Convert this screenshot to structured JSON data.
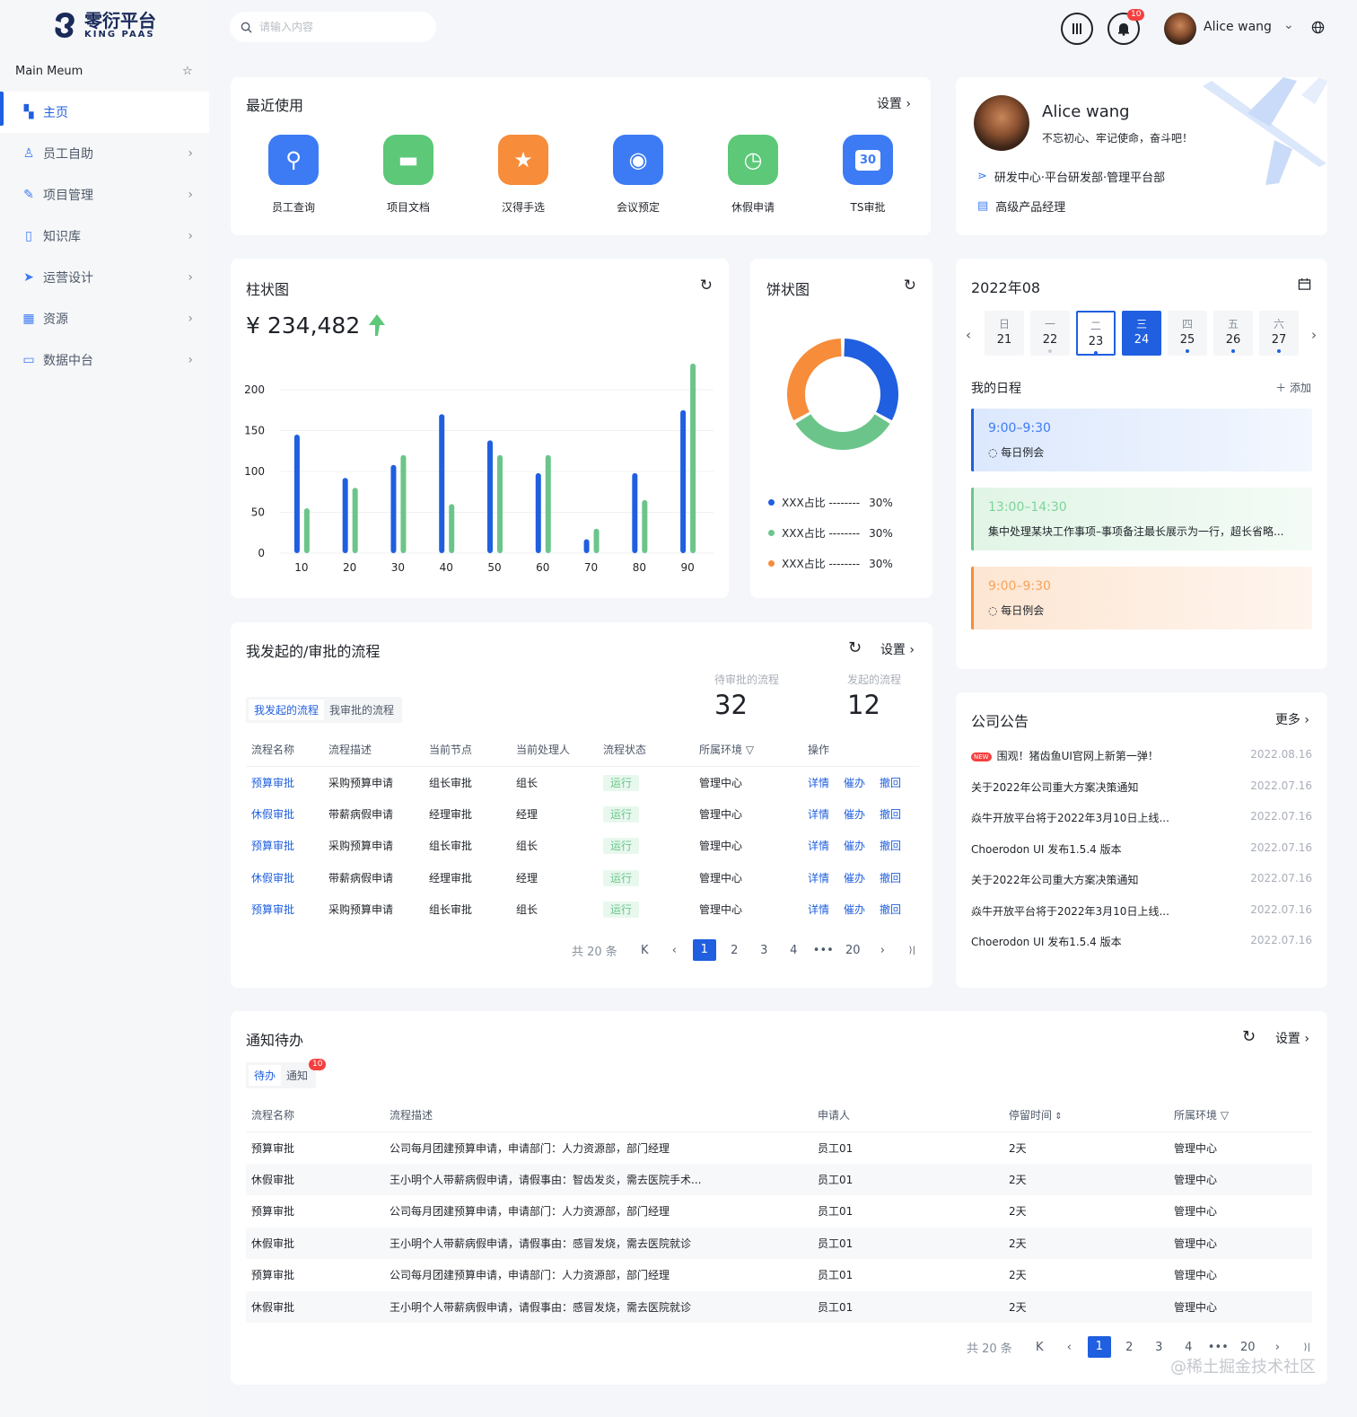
{
  "brand": {
    "name": "零衍平台",
    "sub": "KING PAAS"
  },
  "menu": {
    "title": "Main Meum",
    "items": [
      {
        "label": "主页",
        "icon": "dashboard-icon",
        "active": true
      },
      {
        "label": "员工自助",
        "icon": "user-icon"
      },
      {
        "label": "项目管理",
        "icon": "edit-icon"
      },
      {
        "label": "知识库",
        "icon": "book-icon"
      },
      {
        "label": "运营设计",
        "icon": "send-icon"
      },
      {
        "label": "资源",
        "icon": "grid-icon"
      },
      {
        "label": "数据中台",
        "icon": "monitor-icon"
      }
    ]
  },
  "header": {
    "search_placeholder": "请输入内容",
    "notif_count": "10",
    "user_name": "Alice wang"
  },
  "recent": {
    "title": "最近使用",
    "settings": "设置",
    "apps": [
      {
        "label": "员工查询",
        "color": "#3d7bf4",
        "icon": "user-search-icon"
      },
      {
        "label": "项目文档",
        "color": "#5cc878",
        "icon": "folder-icon"
      },
      {
        "label": "汉得手选",
        "color": "#f78c3a",
        "icon": "star-hand-icon"
      },
      {
        "label": "会议预定",
        "color": "#3d7bf4",
        "icon": "projector-icon"
      },
      {
        "label": "休假申请",
        "color": "#5cc878",
        "icon": "luggage-icon"
      },
      {
        "label": "TS审批",
        "color": "#3d7bf4",
        "icon": "calendar-30-icon",
        "glyph": "30"
      }
    ]
  },
  "profile": {
    "name": "Alice wang",
    "motto": "不忘初心、牢记使命，奋斗吧！",
    "dept": "研发中心·平台研发部·管理平台部",
    "role": "高级产品经理"
  },
  "bar_card": {
    "title": "柱状图",
    "amount": "¥ 234,482"
  },
  "chart_data": [
    {
      "type": "bar",
      "title": "柱状图",
      "categories": [
        "10",
        "20",
        "30",
        "40",
        "50",
        "60",
        "70",
        "80",
        "90"
      ],
      "series": [
        {
          "values": [
            145,
            92,
            108,
            170,
            138,
            98,
            17,
            98,
            175
          ],
          "color": "#1f5fe0"
        },
        {
          "values": [
            55,
            80,
            120,
            60,
            120,
            120,
            30,
            65,
            232
          ],
          "color": "#6bc58a"
        }
      ],
      "ylim": [
        0,
        200
      ],
      "yticks": [
        0,
        50,
        100,
        150,
        200
      ],
      "grid": true
    },
    {
      "type": "pie",
      "title": "饼状图",
      "slices": [
        {
          "label": "XXX占比",
          "value": 30,
          "color": "#1f5fe0"
        },
        {
          "label": "XXX占比",
          "value": 30,
          "color": "#6bc58a"
        },
        {
          "label": "XXX占比",
          "value": 30,
          "color": "#f78c3a"
        }
      ]
    }
  ],
  "pie_card": {
    "title": "饼状图",
    "legend": [
      {
        "label": "XXX占比 --------",
        "pct": "30%",
        "color": "#1f5fe0"
      },
      {
        "label": "XXX占比 --------",
        "pct": "30%",
        "color": "#6bc58a"
      },
      {
        "label": "XXX占比 --------",
        "pct": "30%",
        "color": "#f78c3a"
      }
    ]
  },
  "calendar": {
    "title": "2022年08",
    "days": [
      {
        "wk": "日",
        "d": "21",
        "dot": false
      },
      {
        "wk": "一",
        "d": "22",
        "dot": true,
        "dotColor": "#c9cdd4"
      },
      {
        "wk": "二",
        "d": "23",
        "dot": true,
        "sel": true
      },
      {
        "wk": "三",
        "d": "24",
        "dot": false,
        "today": true
      },
      {
        "wk": "四",
        "d": "25",
        "dot": true
      },
      {
        "wk": "五",
        "d": "26",
        "dot": true
      },
      {
        "wk": "六",
        "d": "27",
        "dot": true
      }
    ],
    "my_schedule": "我的日程",
    "add": "添加",
    "events": [
      {
        "time": "9:00–9:30",
        "desc": "每日例会",
        "color": "#1f5fe0",
        "bg": "linear-gradient(90deg,#dce8fd,#f3f7fe)",
        "tcolor": "#3d7bf4"
      },
      {
        "time": "13:00–14:30",
        "desc": "集中处理某块工作事项–事项备注最长展示为一行，超长省略...",
        "color": "#6bc58a",
        "bg": "linear-gradient(90deg,#e1f5e6,#f4fbf6)",
        "tcolor": "#7fd39a"
      },
      {
        "time": "9:00–9:30",
        "desc": "每日例会",
        "color": "#f78c3a",
        "bg": "linear-gradient(90deg,#fde6d3,#fef5ee)",
        "tcolor": "#f7a35c"
      }
    ]
  },
  "flow": {
    "title": "我发起的/审批的流程",
    "settings": "设置",
    "tab_mine": "我发起的流程",
    "tab_approve": "我审批的流程",
    "pending_label": "待审批的流程",
    "pending_value": "32",
    "started_label": "发起的流程",
    "started_value": "12",
    "columns": [
      "流程名称",
      "流程描述",
      "当前节点",
      "当前处理人",
      "流程状态",
      "所属环境",
      "操作"
    ],
    "rows": [
      {
        "name": "预算审批",
        "desc": "采购预算申请",
        "node": "组长审批",
        "handler": "组长",
        "status": "运行",
        "env": "管理中心"
      },
      {
        "name": "休假审批",
        "desc": "带薪病假申请",
        "node": "经理审批",
        "handler": "经理",
        "status": "运行",
        "env": "管理中心"
      },
      {
        "name": "预算审批",
        "desc": "采购预算申请",
        "node": "组长审批",
        "handler": "组长",
        "status": "运行",
        "env": "管理中心"
      },
      {
        "name": "休假审批",
        "desc": "带薪病假申请",
        "node": "经理审批",
        "handler": "经理",
        "status": "运行",
        "env": "管理中心"
      },
      {
        "name": "预算审批",
        "desc": "采购预算申请",
        "node": "组长审批",
        "handler": "组长",
        "status": "运行",
        "env": "管理中心"
      }
    ],
    "ops": [
      "详情",
      "催办",
      "撤回"
    ],
    "total": "共 20 条",
    "pages": [
      "1",
      "2",
      "3",
      "4",
      "•••",
      "20"
    ]
  },
  "notices": {
    "title": "公司公告",
    "more": "更多",
    "items": [
      {
        "text": "围观！猪齿鱼UI官网上新第一弹！",
        "date": "2022.08.16",
        "new": true
      },
      {
        "text": "关于2022年公司重大方案决策通知",
        "date": "2022.07.16"
      },
      {
        "text": "焱牛开放平台将于2022年3月10日上线...",
        "date": "2022.07.16"
      },
      {
        "text": "Choerodon UI 发布1.5.4 版本",
        "date": "2022.07.16"
      },
      {
        "text": "关于2022年公司重大方案决策通知",
        "date": "2022.07.16"
      },
      {
        "text": "焱牛开放平台将于2022年3月10日上线...",
        "date": "2022.07.16"
      },
      {
        "text": "Choerodon UI 发布1.5.4 版本",
        "date": "2022.07.16"
      }
    ]
  },
  "todo": {
    "title": "通知待办",
    "settings": "设置",
    "tab_todo": "待办",
    "tab_notice": "通知",
    "notice_count": "10",
    "columns": [
      "流程名称",
      "流程描述",
      "申请人",
      "停留时间",
      "所属环境"
    ],
    "rows": [
      {
        "name": "预算审批",
        "desc": "公司每月团建预算申请，申请部门：人力资源部，部门经理",
        "user": "员工01",
        "time": "2天",
        "env": "管理中心"
      },
      {
        "name": "休假审批",
        "desc": "王小明个人带薪病假申请，请假事由：智齿发炎，需去医院手术...",
        "user": "员工01",
        "time": "2天",
        "env": "管理中心"
      },
      {
        "name": "预算审批",
        "desc": "公司每月团建预算申请，申请部门：人力资源部，部门经理",
        "user": "员工01",
        "time": "2天",
        "env": "管理中心"
      },
      {
        "name": "休假审批",
        "desc": "王小明个人带薪病假申请，请假事由：感冒发烧，需去医院就诊",
        "user": "员工01",
        "time": "2天",
        "env": "管理中心"
      },
      {
        "name": "预算审批",
        "desc": "公司每月团建预算申请，申请部门：人力资源部，部门经理",
        "user": "员工01",
        "time": "2天",
        "env": "管理中心"
      },
      {
        "name": "休假审批",
        "desc": "王小明个人带薪病假申请，请假事由：感冒发烧，需去医院就诊",
        "user": "员工01",
        "time": "2天",
        "env": "管理中心"
      }
    ],
    "total": "共 20 条",
    "pages": [
      "1",
      "2",
      "3",
      "4",
      "•••",
      "20"
    ]
  },
  "watermark": "@稀土掘金技术社区"
}
